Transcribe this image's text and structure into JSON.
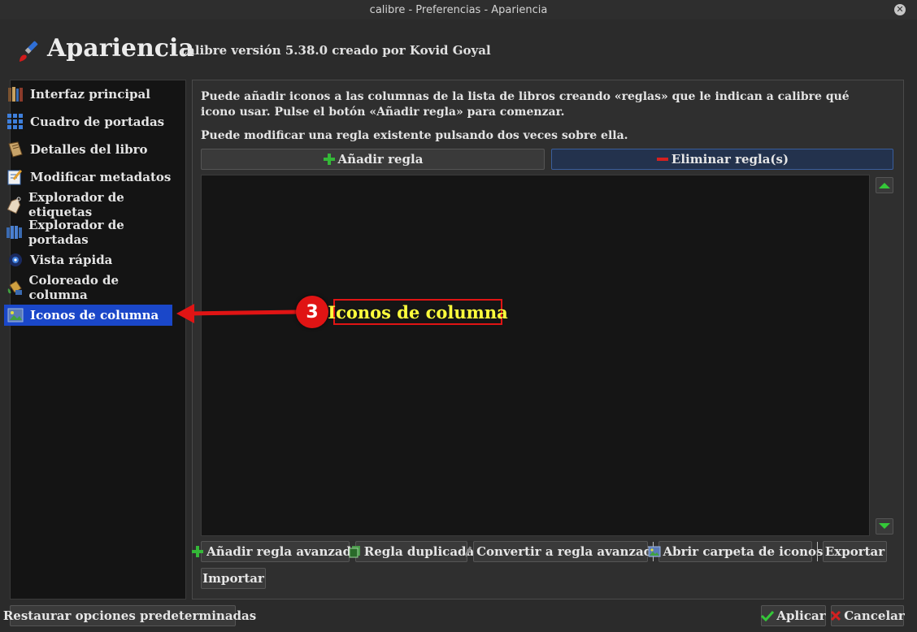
{
  "window": {
    "title": "calibre - Preferencias - Apariencia"
  },
  "header": {
    "title": "Apariencia",
    "version": "calibre versión 5.38.0 creado por Kovid Goyal"
  },
  "sidebar": {
    "items": [
      {
        "label": "Interfaz principal",
        "icon": "books-icon"
      },
      {
        "label": "Cuadro de portadas",
        "icon": "grid-icon"
      },
      {
        "label": "Detalles del libro",
        "icon": "book-icon"
      },
      {
        "label": "Modificar metadatos",
        "icon": "edit-icon"
      },
      {
        "label": "Explorador de etiquetas",
        "icon": "tag-icon"
      },
      {
        "label": "Explorador de portadas",
        "icon": "cover-browser-icon"
      },
      {
        "label": "Vista rápida",
        "icon": "quickview-icon"
      },
      {
        "label": "Coloreado de columna",
        "icon": "paint-bucket-icon"
      },
      {
        "label": "Iconos de columna",
        "icon": "column-icons-icon",
        "selected": true
      }
    ]
  },
  "main": {
    "description_1": "Puede añadir iconos a las columnas de la lista de libros creando «reglas» que le indican a calibre qué icono usar. Pulse el botón «Añadir regla» para comenzar.",
    "description_2": "Puede modificar una regla existente pulsando dos veces sobre ella.",
    "add_rule_label": "Añadir regla",
    "remove_rules_label": "Eliminar regla(s)",
    "bottom_buttons": {
      "add_advanced": "Añadir regla avanzada",
      "duplicate": "Regla duplicada",
      "convert": "Convertir a regla avanzada",
      "open_folder": "Abrir carpeta de iconos",
      "export": "Exportar",
      "import": "Importar"
    }
  },
  "footer": {
    "restore_label": "Restaurar opciones predeterminadas",
    "apply_label": "Aplicar",
    "cancel_label": "Cancelar"
  },
  "annotation": {
    "number": "3",
    "label": "Iconos de columna"
  },
  "colors": {
    "selected": "#1a47c9",
    "annotation_red": "#e01414",
    "annotation_yellow": "#ffff3c"
  }
}
